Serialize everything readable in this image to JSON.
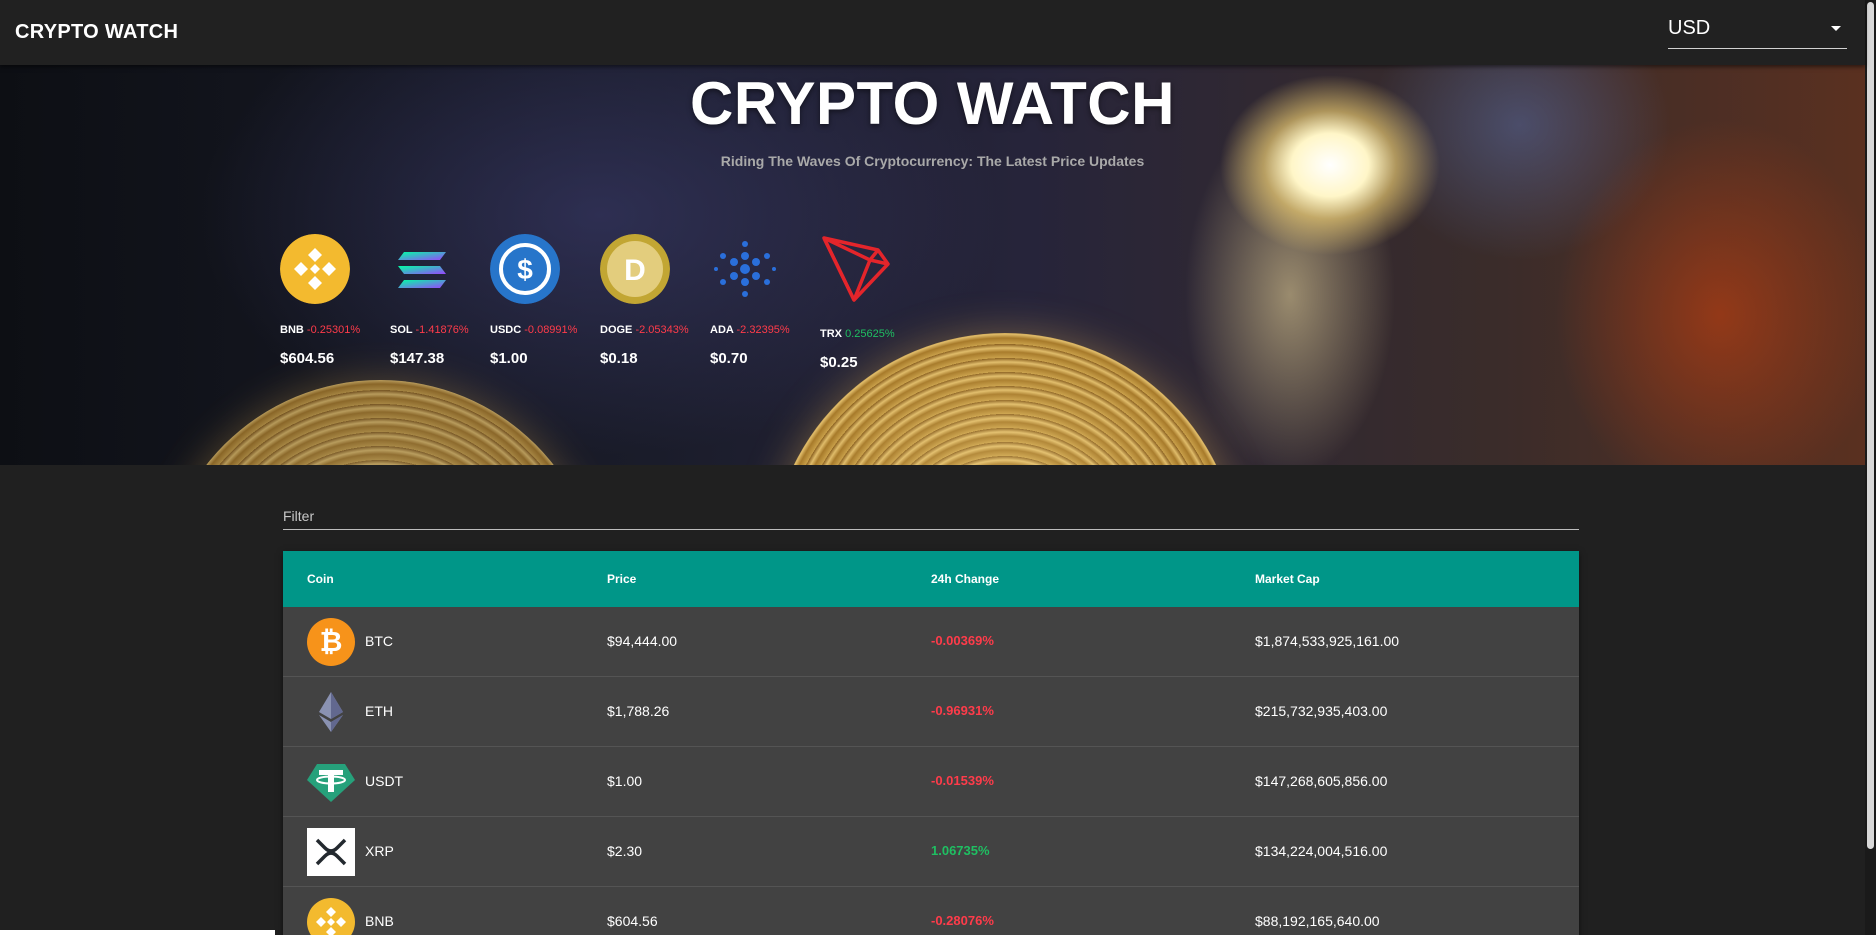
{
  "app": {
    "brand": "CRYPTO WATCH"
  },
  "currency_select": {
    "value": "USD"
  },
  "hero": {
    "title": "CRYPTO WATCH",
    "subtitle": "Riding The Waves Of Cryptocurrency: The Latest Price Updates",
    "carousel": [
      {
        "symbol": "BNB",
        "change": "-0.25301%",
        "price": "$604.56",
        "trend": "down",
        "icon": "bnb-icon"
      },
      {
        "symbol": "SOL",
        "change": "-1.41876%",
        "price": "$147.38",
        "trend": "down",
        "icon": "sol-icon"
      },
      {
        "symbol": "USDC",
        "change": "-0.08991%",
        "price": "$1.00",
        "trend": "down",
        "icon": "usdc-icon"
      },
      {
        "symbol": "DOGE",
        "change": "-2.05343%",
        "price": "$0.18",
        "trend": "down",
        "icon": "doge-icon"
      },
      {
        "symbol": "ADA",
        "change": "-2.32395%",
        "price": "$0.70",
        "trend": "down",
        "icon": "ada-icon"
      },
      {
        "symbol": "TRX",
        "change": "0.25625%",
        "price": "$0.25",
        "trend": "up",
        "icon": "trx-icon"
      }
    ]
  },
  "filter": {
    "label": "Filter"
  },
  "table": {
    "headers": {
      "coin": "Coin",
      "price": "Price",
      "change": "24h Change",
      "market_cap": "Market Cap"
    },
    "rows": [
      {
        "symbol": "BTC",
        "price": "$94,444.00",
        "change": "-0.00369%",
        "market_cap": "$1,874,533,925,161.00",
        "trend": "down",
        "icon": "btc-icon"
      },
      {
        "symbol": "ETH",
        "price": "$1,788.26",
        "change": "-0.96931%",
        "market_cap": "$215,732,935,403.00",
        "trend": "down",
        "icon": "eth-icon"
      },
      {
        "symbol": "USDT",
        "price": "$1.00",
        "change": "-0.01539%",
        "market_cap": "$147,268,605,856.00",
        "trend": "down",
        "icon": "usdt-icon"
      },
      {
        "symbol": "XRP",
        "price": "$2.30",
        "change": "1.06735%",
        "market_cap": "$134,224,004,516.00",
        "trend": "up",
        "icon": "xrp-icon"
      },
      {
        "symbol": "BNB",
        "price": "$604.56",
        "change": "-0.28076%",
        "market_cap": "$88,192,165,640.00",
        "trend": "down",
        "icon": "bnb-icon"
      }
    ]
  },
  "colors": {
    "header_teal": "#009688",
    "negative": "#ff3b4a",
    "positive": "#1fbf62",
    "table_bg": "#424242",
    "page_bg": "#202020"
  }
}
